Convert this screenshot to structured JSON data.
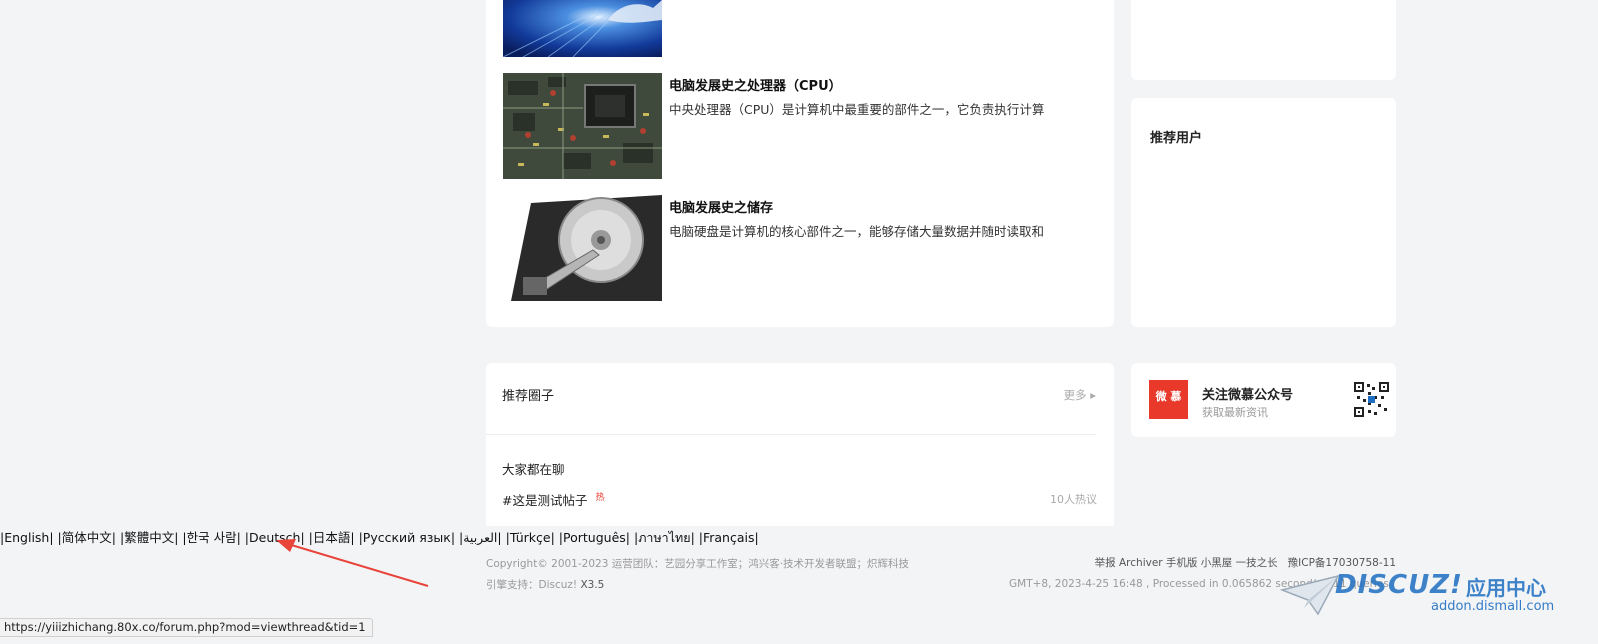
{
  "articles": [
    {
      "title": "",
      "desc": ""
    },
    {
      "title": "电脑发展史之处理器（CPU）",
      "desc": "中央处理器（CPU）是计算机中最重要的部件之一，它负责执行计算"
    },
    {
      "title": "电脑发展史之储存",
      "desc": "电脑硬盘是计算机的核心部件之一，能够存储大量数据并随时读取和"
    }
  ],
  "sidebar": {
    "recommended_users_title": "推荐用户",
    "wechat": {
      "logo_text": "微 慕",
      "title": "关注微慕公众号",
      "subtitle": "获取最新资讯"
    }
  },
  "circles": {
    "title": "推荐圈子",
    "more_label": "更多 ▸",
    "section_label": "大家都在聊",
    "topic": {
      "label": "#这是测试帖子",
      "hot_badge": "热",
      "count": "10人热议"
    }
  },
  "languages": [
    "English",
    "简体中文",
    "繁體中文",
    "한국 사람",
    "Deutsch",
    "日本語",
    "Русский язык",
    "العربية",
    "Türkçe",
    "Português",
    "ภาษาไทย",
    "Français"
  ],
  "footer": {
    "copyright": "Copyright© 2001-2023 运营团队：艺园分享工作室；鸿兴客·技术开发者联盟；炽辉科技",
    "powered_prefix": "引擎支持：Discuz! ",
    "powered_version": "X3.5",
    "right_links": "举报 Archiver 手机版 小黑屋 一技之长",
    "icp": "豫ICP备17030758-11",
    "time_info": "GMT+8, 2023-4-25 16:48 , Processed in 0.065862 second(s), 11 queries ."
  },
  "watermark": {
    "brand": "DISCUZ!",
    "cn": "应用中心",
    "url": "addon.dismall.com"
  },
  "status_bar_url": "https://yiiizhichang.80x.co/forum.php?mod=viewthread&tid=1",
  "colors": {
    "bg": "#f3f4f6",
    "card": "#ffffff",
    "wechat_red": "#e8392b",
    "hot_red": "#e8392b",
    "arrow_red": "#e8443a",
    "watermark_blue": "#1e6fc2"
  }
}
